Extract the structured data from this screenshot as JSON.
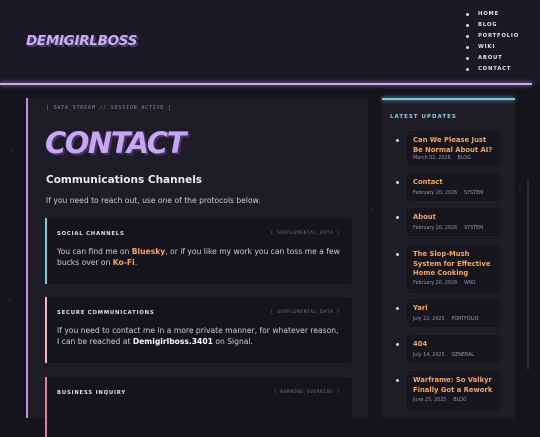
{
  "site": {
    "logo": "DEMIGIRLBOSS"
  },
  "nav": {
    "items": [
      "HOME",
      "BLOG",
      "PORTFOLIO",
      "WIKI",
      "ABOUT",
      "CONTACT"
    ]
  },
  "main": {
    "session": "[ DATA_STREAM // SESSION_ACTIVE ]",
    "title": "CONTACT",
    "subtitle": "Communications Channels",
    "intro": "If you need to reach out, use one of the protocols below.",
    "cards": [
      {
        "title": "SOCIAL CHANNELS",
        "tag": "[ SUPPLEMENTAL_DATA ]",
        "accent": "#7fc8d8",
        "body_pre": "You can find me on ",
        "link1": "Bluesky",
        "body_mid": ", or if you like my work you can toss me a few bucks over on ",
        "link2": "Ko-Fi",
        "body_post": "."
      },
      {
        "title": "SECURE COMMUNICATIONS",
        "tag": "[ SUPPLEMENTAL_DATA ]",
        "accent": "#f0b8c4",
        "body_pre": "If you need to contact me in a more private manner, for whatever reason, I can be reached at ",
        "handle": "Demigirlboss.3401",
        "body_post": " on Signal."
      },
      {
        "title": "BUSINESS INQUIRY",
        "tag": "[ WARNING_OVERRIDE ]",
        "accent": "#e07f9a"
      }
    ]
  },
  "sidebar": {
    "heading": "LATEST UPDATES",
    "items": [
      {
        "title": "Can We Please Just Be Normal About AI?",
        "date": "March 02, 2026",
        "category": "BLOG"
      },
      {
        "title": "Contact",
        "date": "February 20, 2026",
        "category": "SYSTEM"
      },
      {
        "title": "About",
        "date": "February 20, 2026",
        "category": "SYSTEM"
      },
      {
        "title": "The Slop-Mush System for Effective Home Cooking",
        "date": "February 20, 2026",
        "category": "WIKI"
      },
      {
        "title": "Yari",
        "date": "July 22, 2025",
        "category": "PORTFOLIO"
      },
      {
        "title": "404",
        "date": "July 14, 2025",
        "category": "GENERAL"
      },
      {
        "title": "Warframe: So Valkyr Finally Got a Rework",
        "date": "June 25, 2025",
        "category": "BLOG"
      }
    ]
  },
  "colors": {
    "accent": "#c8a6f2",
    "link": "#f0a765",
    "cyan": "#7fc8d8",
    "background": "#15131c"
  }
}
